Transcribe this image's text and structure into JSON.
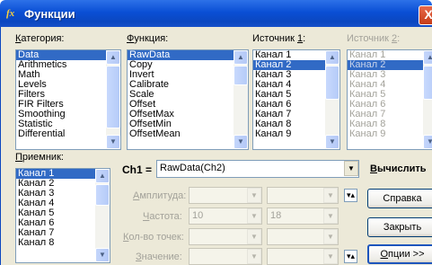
{
  "window": {
    "icon": "fx-icon",
    "title": "Функции",
    "close_glyph": "X"
  },
  "category": {
    "label_u": "К",
    "label_rest": "атегория:",
    "items": [
      "Data",
      "Arithmetics",
      "Math",
      "Levels",
      "Filters",
      "FIR Filters",
      "Smoothing",
      "Statistic",
      "Differential"
    ],
    "selected": "Data"
  },
  "function": {
    "label_u": "Ф",
    "label_rest": "ункция:",
    "items": [
      "RawData",
      "Copy",
      "Invert",
      "Calibrate",
      "Scale",
      "Offset",
      "OffsetMax",
      "OffsetMin",
      "OffsetMean"
    ],
    "selected": "RawData"
  },
  "source1": {
    "label_pre": "Источник ",
    "label_u": "1",
    "label_post": ":",
    "items": [
      "Канал 1",
      "Канал 2",
      "Канал 3",
      "Канал 4",
      "Канал 5",
      "Канал 6",
      "Канал 7",
      "Канал 8",
      "Канал 9"
    ],
    "selected": "Канал 2"
  },
  "source2": {
    "label_pre": "Источник ",
    "label_u": "2",
    "label_post": ":",
    "items": [
      "Канал 1",
      "Канал 2",
      "Канал 3",
      "Канал 4",
      "Канал 5",
      "Канал 6",
      "Канал 7",
      "Канал 8",
      "Канал 9"
    ],
    "selected": "Канал 2"
  },
  "receiver": {
    "label_u": "П",
    "label_rest": "риемник:",
    "items": [
      "Канал 1",
      "Канал 2",
      "Канал 3",
      "Канал 4",
      "Канал 5",
      "Канал 6",
      "Канал 7",
      "Канал 8"
    ],
    "selected": "Канал 1"
  },
  "formula": {
    "channel_label": "Ch1 =",
    "value": "RawData(Ch2)"
  },
  "params": {
    "amplitude": {
      "label_u": "А",
      "label_rest": "мплитуда:",
      "value": ""
    },
    "frequency": {
      "label_u": "Ч",
      "label_rest": "астота:",
      "value": "10",
      "value2": "18"
    },
    "points": {
      "label_u": "К",
      "label_rest": "ол-во точек:",
      "value": ""
    },
    "value": {
      "label_u": "З",
      "label_rest": "начение:",
      "value": ""
    }
  },
  "buttons": {
    "compute_u": "В",
    "compute_rest": "ычислить",
    "help": "Справка",
    "close": "Закрыть",
    "options_u": "О",
    "options_rest": "пции >>",
    "expand_glyph": "▾▴"
  }
}
